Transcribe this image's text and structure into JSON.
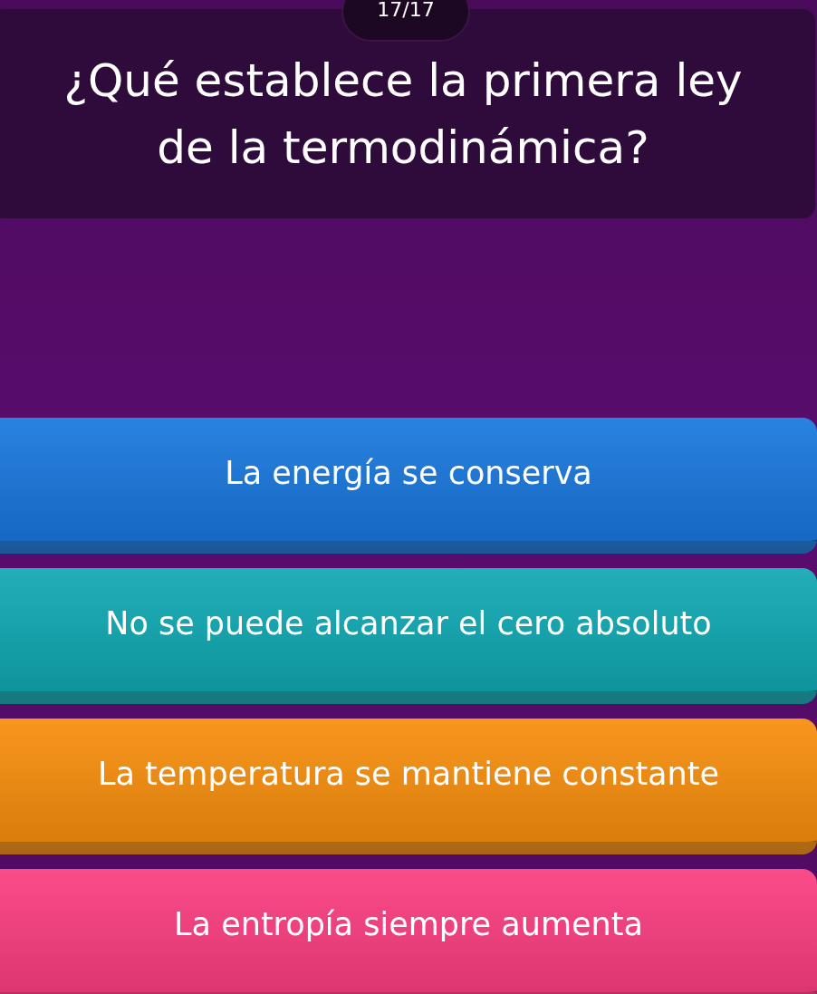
{
  "counter": "17/17",
  "question": "¿Qué establece la primera ley de la termodinámica?",
  "answers": [
    {
      "label": "La energía se conserva",
      "color": "#1877dd"
    },
    {
      "label": "No se puede alcanzar el cero absoluto",
      "color": "#10a8b2"
    },
    {
      "label": "La temperatura se mantiene constante",
      "color": "#f78e0c"
    },
    {
      "label": "La entropía siempre aumenta",
      "color": "#fb3d80"
    }
  ]
}
